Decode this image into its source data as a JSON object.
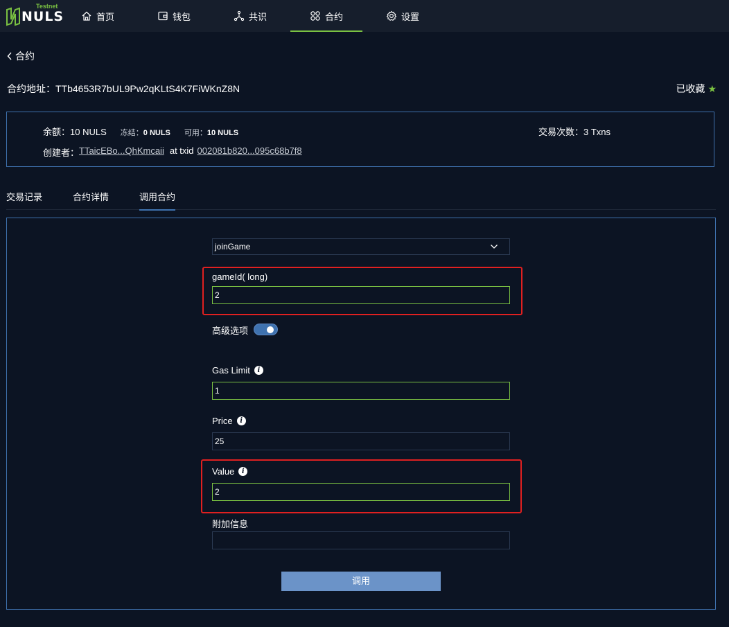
{
  "brand": {
    "name": "NULS",
    "badge": "Testnet",
    "accent": "#7ac142",
    "primary": "#3f72af",
    "alert": "#e02020"
  },
  "nav": [
    {
      "label": "首页",
      "icon": "home-icon"
    },
    {
      "label": "钱包",
      "icon": "wallet-icon"
    },
    {
      "label": "共识",
      "icon": "consensus-icon"
    },
    {
      "label": "合约",
      "icon": "contract-icon",
      "active": true
    },
    {
      "label": "设置",
      "icon": "gear-icon"
    }
  ],
  "back_label": "合约",
  "contract": {
    "address_label": "合约地址：",
    "address": "TTb4653R7bUL9Pw2qKLtS4K7FiWKnZ8N",
    "favorite_label": "已收藏"
  },
  "info": {
    "balance_label": "余额：",
    "balance": "10 NULS",
    "frozen_label": "冻结：",
    "frozen": "0 NULS",
    "available_label": "可用：",
    "available": "10 NULS",
    "tx_count_label": "交易次数：",
    "tx_count": "3 Txns",
    "creator_label": "创建者：",
    "creator": "TTaicEBo...QhKmcaii",
    "at_txid": "at txid",
    "txid": "002081b820...095c68b7f8"
  },
  "tabs": [
    {
      "label": "交易记录"
    },
    {
      "label": "合约详情"
    },
    {
      "label": "调用合约",
      "active": true
    }
  ],
  "form": {
    "method": "joinGame",
    "param_label": "gameId( long)",
    "param_value": "2",
    "advanced_label": "高级选项",
    "advanced_on": true,
    "gas_limit_label": "Gas Limit",
    "gas_limit": "1",
    "price_label": "Price",
    "price": "25",
    "value_label": "Value",
    "value": "2",
    "remark_label": "附加信息",
    "remark": "",
    "submit_label": "调用"
  }
}
